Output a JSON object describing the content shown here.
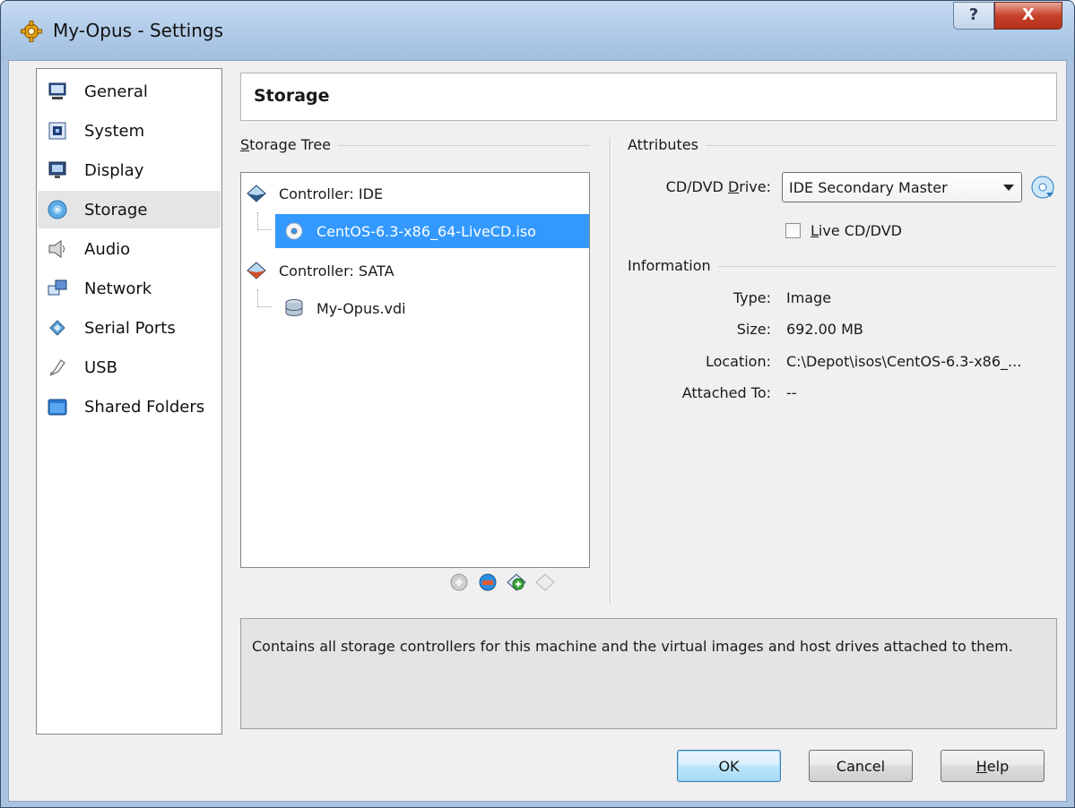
{
  "window": {
    "title": "My-Opus - Settings",
    "help_glyph": "?",
    "close_glyph": "X"
  },
  "sidebar": {
    "items": [
      {
        "label": "General",
        "icon": "monitor-icon"
      },
      {
        "label": "System",
        "icon": "chip-icon"
      },
      {
        "label": "Display",
        "icon": "display-icon"
      },
      {
        "label": "Storage",
        "icon": "disk-icon",
        "selected": true
      },
      {
        "label": "Audio",
        "icon": "speaker-icon"
      },
      {
        "label": "Network",
        "icon": "network-icon"
      },
      {
        "label": "Serial Ports",
        "icon": "serial-port-icon"
      },
      {
        "label": "USB",
        "icon": "usb-icon"
      },
      {
        "label": "Shared Folders",
        "icon": "folder-icon"
      }
    ]
  },
  "page": {
    "title": "Storage"
  },
  "storage_tree": {
    "title_prefix": "S",
    "title_rest": "torage Tree",
    "rows": [
      {
        "label": "Controller: IDE",
        "icon": "ide-controller-icon"
      },
      {
        "label": "CentOS-6.3-x86_64-LiveCD.iso",
        "icon": "cd-icon",
        "selected": true
      },
      {
        "label": "Controller: SATA",
        "icon": "sata-controller-icon"
      },
      {
        "label": "My-Opus.vdi",
        "icon": "hard-disk-icon"
      }
    ],
    "tools": [
      "add-attachment-icon",
      "remove-attachment-icon",
      "add-controller-icon",
      "remove-controller-icon"
    ]
  },
  "attributes": {
    "title": "Attributes",
    "drive_label_pre": "CD/DVD ",
    "drive_label_u": "D",
    "drive_label_post": "rive:",
    "drive_value": "IDE Secondary Master",
    "live_label_u": "L",
    "live_label_rest": "ive CD/DVD",
    "live_checked": false
  },
  "information": {
    "title": "Information",
    "type_label": "Type:",
    "type_value": "Image",
    "size_label": "Size:",
    "size_value": "692.00 MB",
    "location_label": "Location:",
    "location_value": "C:\\Depot\\isos\\CentOS-6.3-x86_...",
    "attached_label": "Attached To:",
    "attached_value": "--"
  },
  "description": "Contains all storage controllers for this machine and the virtual images and host drives attached to them.",
  "buttons": {
    "ok": "OK",
    "cancel": "Cancel",
    "help_u": "H",
    "help_rest": "elp"
  }
}
